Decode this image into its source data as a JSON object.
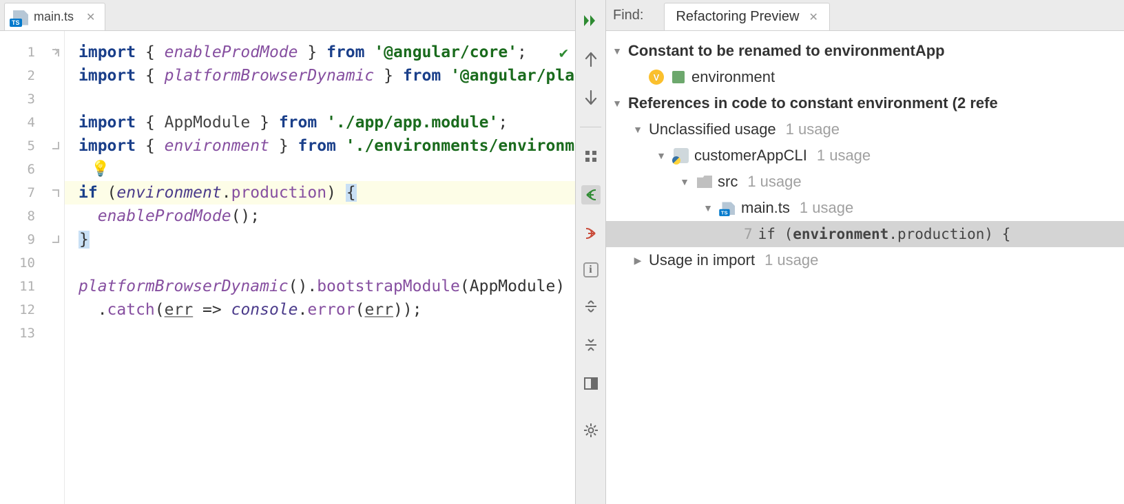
{
  "tab": {
    "title": "main.ts"
  },
  "gutter": [
    "1",
    "2",
    "3",
    "4",
    "5",
    "6",
    "7",
    "8",
    "9",
    "10",
    "11",
    "12",
    "13"
  ],
  "code": {
    "l1": {
      "kw": "import ",
      "br1": "{ ",
      "fn": "enableProdMode",
      "br2": " }",
      "from": " from ",
      "str": "'@angular/core'",
      "semi": ";"
    },
    "l2": {
      "kw": "import ",
      "br1": "{ ",
      "fn": "platformBrowserDynamic",
      "br2": " }",
      "from": " from ",
      "str": "'@angular/plat"
    },
    "l4": {
      "kw": "import ",
      "br1": "{ ",
      "id": "AppModule",
      "br2": " }",
      "from": " from ",
      "str": "'./app/app.module'",
      "semi": ";"
    },
    "l5": {
      "kw": "import ",
      "br1": "{ ",
      "fn": "environment",
      "br2": " }",
      "from": " from ",
      "str": "'./environments/environme"
    },
    "l7": {
      "kw": "if ",
      "lp": "(",
      "env": "environment",
      "dot": ".",
      "prod": "production",
      "rp": ")",
      "sp": " ",
      "brace": "{"
    },
    "l8": {
      "indent": "  ",
      "fn": "enableProdMode",
      "call": "();"
    },
    "l9": {
      "brace": "}"
    },
    "l11": {
      "fn": "platformBrowserDynamic",
      "call": "().",
      "boot": "bootstrapModule",
      "arg": "(AppModule)"
    },
    "l12": {
      "indent": "  .",
      "catch": "catch",
      "lp": "(",
      "err1": "err",
      "arrow": " => ",
      "console": "console",
      "dot": ".",
      "error": "error",
      "lp2": "(",
      "err2": "err",
      "rp": "));"
    }
  },
  "find": {
    "label": "Find:",
    "tab_title": "Refactoring Preview",
    "heading": "Constant to be renamed to environmentApp",
    "item": "environment",
    "refs": "References in code to constant environment (2 refe",
    "unclassified": "Unclassified usage",
    "u1": "1 usage",
    "project": "customerAppCLI",
    "folder": "src",
    "file": "main.ts",
    "usage_line_no": "7",
    "usage_if": "if ",
    "usage_open": "(",
    "usage_env": "environment",
    "usage_rest": ".production) {",
    "import_usage": "Usage in import"
  }
}
